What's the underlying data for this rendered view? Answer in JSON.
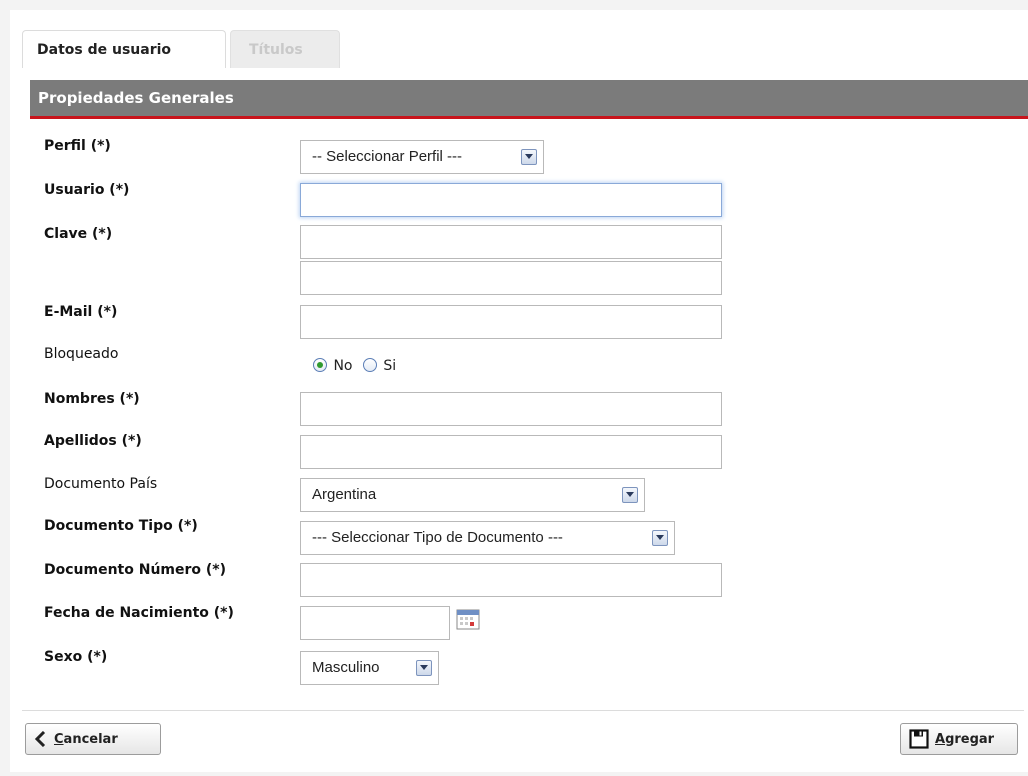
{
  "tabs": [
    {
      "label": "Datos de usuario",
      "active": true
    },
    {
      "label": "Títulos",
      "active": false
    }
  ],
  "section": {
    "title": "Propiedades Generales"
  },
  "form": {
    "perfil": {
      "label": "Perfil (*)",
      "selected": "-- Seleccionar Perfil ---"
    },
    "usuario": {
      "label": "Usuario (*)",
      "value": ""
    },
    "clave": {
      "label": "Clave (*)",
      "value": "",
      "confirm_value": ""
    },
    "email": {
      "label": "E-Mail (*)",
      "value": ""
    },
    "bloqueado": {
      "label": "Bloqueado",
      "options": [
        "No",
        "Si"
      ],
      "selected": "No"
    },
    "nombres": {
      "label": "Nombres (*)",
      "value": ""
    },
    "apellidos": {
      "label": "Apellidos (*)",
      "value": ""
    },
    "documento_pais": {
      "label": "Documento País",
      "selected": "Argentina"
    },
    "documento_tipo": {
      "label": "Documento Tipo (*)",
      "selected": "--- Seleccionar Tipo de Documento ---"
    },
    "documento_numero": {
      "label": "Documento Número (*)",
      "value": ""
    },
    "fecha_nacimiento": {
      "label": "Fecha de Nacimiento (*)",
      "value": ""
    },
    "sexo": {
      "label": "Sexo (*)",
      "selected": "Masculino"
    }
  },
  "footer": {
    "cancel": {
      "access_key": "C",
      "rest": "ancelar"
    },
    "add": {
      "access_key": "A",
      "rest": "gregar"
    }
  }
}
